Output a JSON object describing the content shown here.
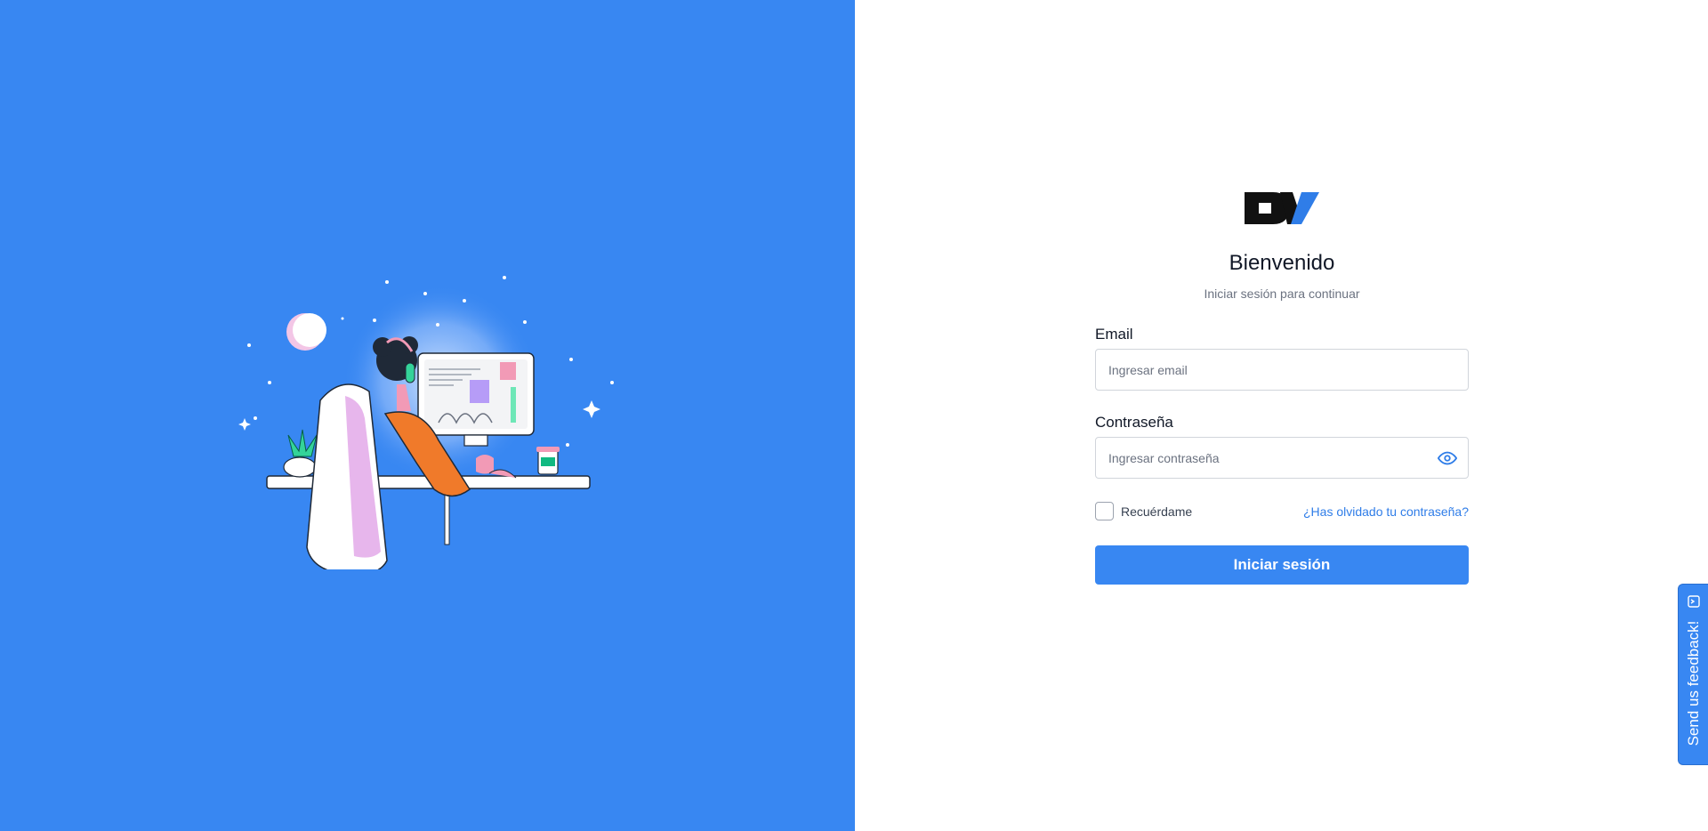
{
  "brand": {
    "logo_alt": "DV logo",
    "accent": "#3887f2",
    "logo_blue": "#2f7de8",
    "logo_dark": "#111111"
  },
  "illustration": {
    "name": "person-at-computer-illustration"
  },
  "login": {
    "title": "Bienvenido",
    "subtitle": "Iniciar sesión para continuar",
    "email": {
      "label": "Email",
      "placeholder": "Ingresar email",
      "value": ""
    },
    "password": {
      "label": "Contraseña",
      "placeholder": "Ingresar contraseña",
      "value": "",
      "toggle_icon": "eye-icon"
    },
    "remember_label": "Recuérdame",
    "remember_checked": false,
    "forgot_label": "¿Has olvidado tu contraseña?",
    "submit_label": "Iniciar sesión"
  },
  "feedback": {
    "label": "Send us feedback!",
    "icon": "feedback-icon"
  }
}
